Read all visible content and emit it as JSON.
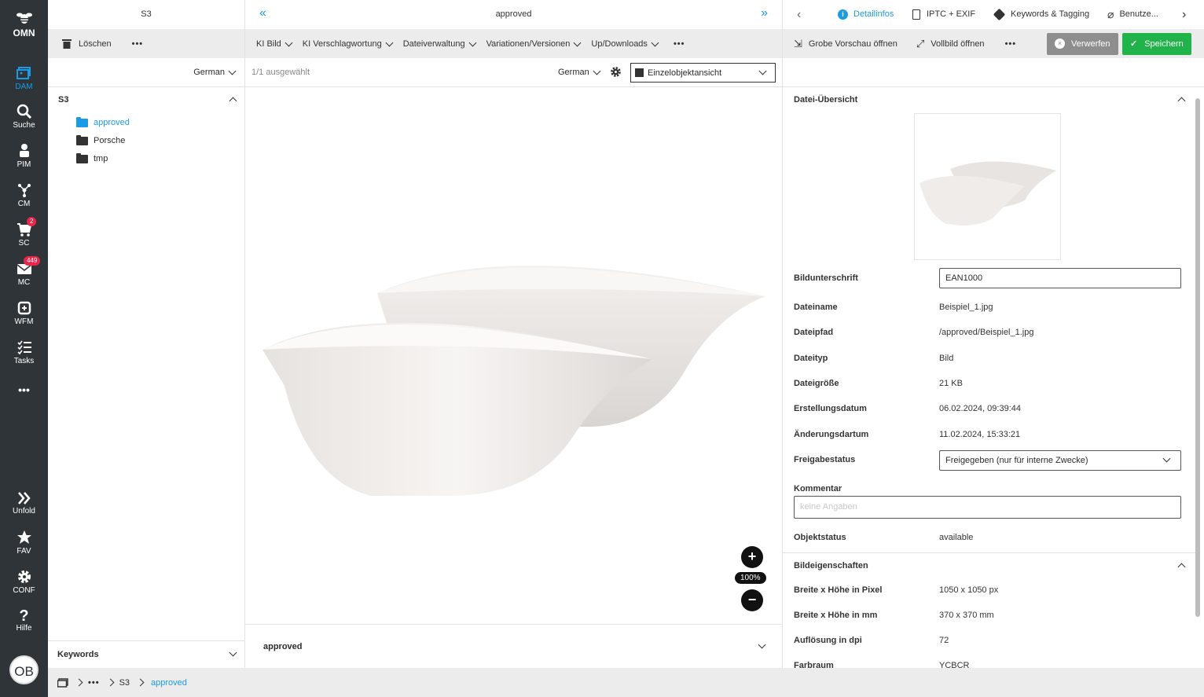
{
  "nav": {
    "logo": "OMN",
    "items": [
      {
        "label": "DAM",
        "icon": "dam-icon"
      },
      {
        "label": "Suche",
        "icon": "search-icon"
      },
      {
        "label": "PIM",
        "icon": "pim-icon"
      },
      {
        "label": "CM",
        "icon": "cm-icon"
      },
      {
        "label": "SC",
        "icon": "cart-icon",
        "badge": "2"
      },
      {
        "label": "MC",
        "icon": "mail-icon",
        "badge": "449"
      },
      {
        "label": "WFM",
        "icon": "workflow-icon"
      },
      {
        "label": "Tasks",
        "icon": "tasks-icon"
      }
    ],
    "more": "•••",
    "bottom": [
      {
        "label": "Unfold"
      },
      {
        "label": "FAV"
      },
      {
        "label": "CONF"
      },
      {
        "label": "Hilfe"
      }
    ],
    "avatar": "OB"
  },
  "colA": {
    "title": "S3",
    "delete": "Löschen",
    "more": "•••",
    "lang": "German",
    "tree_root": "S3",
    "folders": [
      "approved",
      "Porsche",
      "tmp"
    ],
    "keywords": "Keywords"
  },
  "colB": {
    "title": "approved",
    "toolbar": [
      "KI Bild",
      "KI Verschlagwortung",
      "Dateiverwaltung",
      "Variationen/Versionen",
      "Up/Downloads"
    ],
    "more": "•••",
    "selected": "1/1 ausgewählt",
    "lang": "German",
    "view": "Einzelobjektansicht",
    "zoom": "100%",
    "bottom_label": "approved"
  },
  "colC": {
    "tabs": [
      "Detailinfos",
      "IPTC + EXIF",
      "Keywords & Tagging",
      "Benutze..."
    ],
    "coarse_preview": "Grobe Vorschau öffnen",
    "full_image": "Vollbild öffnen",
    "more": "•••",
    "discard": "Verwerfen",
    "save": "Speichern",
    "section1": "Datei-Übersicht",
    "caption_label": "Bildunterschrift",
    "caption_value": "EAN1000",
    "fields": [
      {
        "label": "Dateiname",
        "value": "Beispiel_1.jpg"
      },
      {
        "label": "Dateipfad",
        "value": "/approved/Beispiel_1.jpg"
      },
      {
        "label": "Dateityp",
        "value": "Bild"
      },
      {
        "label": "Dateigröße",
        "value": "21 KB"
      },
      {
        "label": "Erstellungsdatum",
        "value": "06.02.2024, 09:39:44"
      },
      {
        "label": "Änderungsdartum",
        "value": "11.02.2024, 15:33:21"
      }
    ],
    "release_label": "Freigabestatus",
    "release_value": "Freigegeben (nur für interne Zwecke)",
    "comment_label": "Kommentar",
    "comment_placeholder": "keine Angaben",
    "objstatus_label": "Objektstatus",
    "objstatus_value": "available",
    "section2": "Bildeigenschaften",
    "props": [
      {
        "label": "Breite x Höhe in Pixel",
        "value": "1050 x 1050 px"
      },
      {
        "label": "Breite x Höhe in mm",
        "value": "370 x 370 mm"
      },
      {
        "label": "Auflösung in dpi",
        "value": "72"
      },
      {
        "label": "Farbraum",
        "value": "YCBCR"
      }
    ]
  },
  "footer": {
    "crumbs": [
      "•••",
      "S3",
      "approved"
    ]
  }
}
